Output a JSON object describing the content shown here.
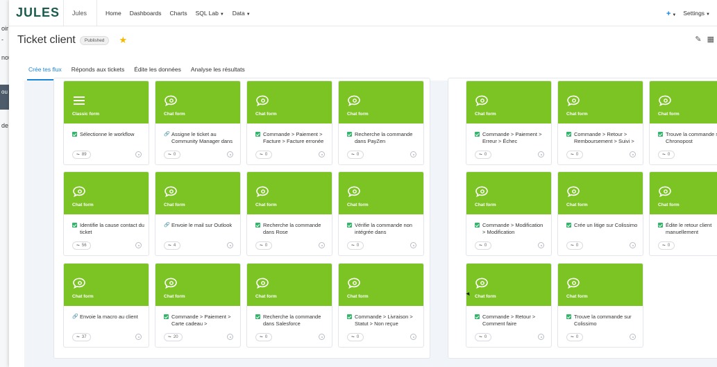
{
  "background_window": {
    "fragments": [
      "oir",
      "-",
      "nou",
      "ou",
      "de l"
    ]
  },
  "app": {
    "logo": "JULES",
    "name": "Jules",
    "nav": [
      {
        "label": "Home",
        "dropdown": false
      },
      {
        "label": "Dashboards",
        "dropdown": false
      },
      {
        "label": "Charts",
        "dropdown": false
      },
      {
        "label": "SQL Lab",
        "dropdown": true
      },
      {
        "label": "Data",
        "dropdown": true
      }
    ],
    "add_label": "+",
    "settings_label": "Settings"
  },
  "dashboard": {
    "title": "Ticket client",
    "status": "Published",
    "favorite": true
  },
  "tabs": [
    {
      "label": "Crée tes flux",
      "active": true
    },
    {
      "label": "Réponds aux tickets",
      "active": false
    },
    {
      "label": "Édite les données",
      "active": false
    },
    {
      "label": "Analyse les résultats",
      "active": false
    }
  ],
  "colors": {
    "accent": "#7cc423",
    "tab_active": "#1a85d6",
    "check": "#33b56b",
    "logo": "#1b5b4e"
  },
  "cards_left": [
    {
      "type": "Classic form",
      "icon": "list-icon",
      "status": "check",
      "label": "Sélectionne le workflow",
      "count": "89"
    },
    {
      "type": "Chat form",
      "icon": "chat-icon",
      "status": "link",
      "label": "Assigne le ticket au Community Manager dans",
      "count": "0"
    },
    {
      "type": "Chat form",
      "icon": "chat-icon",
      "status": "check",
      "label": "Commande > Paiement > Facture > Facture erronée",
      "count": "0"
    },
    {
      "type": "Chat form",
      "icon": "chat-icon",
      "status": "check",
      "label": "Recherche la commande dans PayZen",
      "count": "0"
    },
    {
      "type": "Chat form",
      "icon": "chat-icon",
      "status": "check",
      "label": "Identifie la cause contact du ticket",
      "count": "56"
    },
    {
      "type": "Chat form",
      "icon": "chat-icon",
      "status": "link",
      "label": "Envoie le mail sur Outlook",
      "count": "4"
    },
    {
      "type": "Chat form",
      "icon": "chat-icon",
      "status": "check",
      "label": "Recherche la commande dans Rose",
      "count": "0"
    },
    {
      "type": "Chat form",
      "icon": "chat-icon",
      "status": "check",
      "label": "Vérifie la commande non intégrée dans",
      "count": "0"
    },
    {
      "type": "Chat form",
      "icon": "chat-icon",
      "status": "link",
      "label": "Envoie la macro au client",
      "count": "37"
    },
    {
      "type": "Chat form",
      "icon": "chat-icon",
      "status": "check",
      "label": "Commande > Paiement > Carte cadeau >",
      "count": "20"
    },
    {
      "type": "Chat form",
      "icon": "chat-icon",
      "status": "check",
      "label": "Recherche la commande dans Salesforce",
      "count": "0"
    },
    {
      "type": "Chat form",
      "icon": "chat-icon",
      "status": "check",
      "label": "Commande > Livraison > Statut > Non reçue",
      "count": "0"
    }
  ],
  "cards_right": [
    {
      "type": "Chat form",
      "icon": "chat-icon",
      "status": "check",
      "label": "Commande > Paiement > Erreur > Échec",
      "count": "0"
    },
    {
      "type": "Chat form",
      "icon": "chat-icon",
      "status": "check",
      "label": "Commande > Retour > Remboursement > Suivi >",
      "count": "0"
    },
    {
      "type": "Chat form",
      "icon": "chat-icon",
      "status": "check",
      "label": "Trouve la commande sur Chronopost",
      "count": "0"
    },
    {
      "type": "Chat form",
      "icon": "chat-icon",
      "status": "check",
      "label": "Commande > Modification > Modification",
      "count": "0"
    },
    {
      "type": "Chat form",
      "icon": "chat-icon",
      "status": "check",
      "label": "Crée un litige sur Colissimo",
      "count": "0"
    },
    {
      "type": "Chat form",
      "icon": "chat-icon",
      "status": "check",
      "label": "Édite le retour client manuellement",
      "count": "0"
    },
    {
      "type": "Chat form",
      "icon": "chat-icon",
      "status": "check",
      "label": "Commande > Retour > Comment faire",
      "count": "0"
    },
    {
      "type": "Chat form",
      "icon": "chat-icon",
      "status": "check",
      "label": "Trouve la commande sur Colissimo",
      "count": "0"
    }
  ]
}
